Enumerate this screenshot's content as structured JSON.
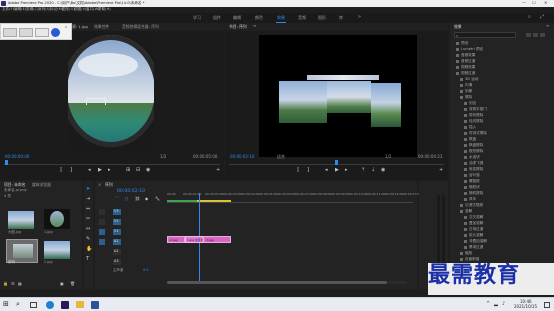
{
  "titlebar": {
    "title": "Adobe Premiere Pro 2020 - C:\\用户\\Bo\\文档\\Adobe\\Premiere Pro\\14.0\\未命名 *"
  },
  "menu": [
    "文件(F)",
    "编辑(E)",
    "剪辑(C)",
    "序列(S)",
    "标记(M)",
    "图形(G)",
    "视图(V)",
    "窗口(W)",
    "帮助(H)"
  ],
  "workspaces": [
    "学习",
    "组件",
    "编辑",
    "颜色",
    "效果",
    "音频",
    "图形",
    "库"
  ],
  "active_workspace": "效果",
  "source_monitor": {
    "tabs": [
      "源: 1.jpg",
      "效果控件",
      "音频剪辑混合器: 序列"
    ],
    "timecode_left": "00:00:00:00",
    "zoom": "1/2",
    "timecode_right": "00:00:05:00"
  },
  "program_monitor": {
    "tab": "节目: 序列",
    "timecode_left": "00:00:02:10",
    "fit": "适合",
    "zoom": "1/2",
    "timecode_right": "00:00:04:23"
  },
  "project": {
    "tabs": [
      "项目: 未命名",
      "媒体浏览器"
    ],
    "name": "未命名.prproj",
    "item_count": "4 项",
    "items": [
      {
        "label": "大图.jpg",
        "duration": "5:00"
      },
      {
        "label": "1.jpg",
        "duration": "5:00"
      },
      {
        "label": "序列",
        "duration": "4:23"
      },
      {
        "label": "2.jpg",
        "duration": "5:00"
      }
    ]
  },
  "timeline": {
    "tab": "序列",
    "timecode": "00:00:02:10",
    "ruler": [
      "00:00",
      "00:00:01:00",
      "00:00:02:00",
      "00:00:03:00",
      "00:00:04:00",
      "00:00:05:00",
      "00:00:06:00",
      "00:00:07:00",
      "00:00:08:00",
      "00:00:09:00",
      "00:00:10:00",
      "00:00:11:00",
      "00:00:12:00",
      "00:00:13:00",
      "00:00:14:00"
    ],
    "tracks": [
      "V3",
      "V2",
      "V1",
      "A1",
      "A2",
      "A3"
    ],
    "master_label": "主声道",
    "master_value": "0.0",
    "clips": [
      "2.jpg",
      "1.jpg 交叉溶解",
      "2.jpg"
    ]
  },
  "effects": {
    "title": "效果",
    "rows": [
      "预设",
      "Lumetri 预设",
      "音频效果",
      "音频过渡",
      "视频效果",
      "视频过渡",
      "3D 运动",
      "内滑",
      "划像",
      "擦除",
      "划出",
      "双侧平推门",
      "带状擦除",
      "径向擦除",
      "插入",
      "时钟式擦除",
      "棋盘",
      "棋盘擦除",
      "楔形擦除",
      "水波块",
      "油漆飞溅",
      "渐变擦除",
      "百叶窗",
      "螺旋框",
      "随机块",
      "随机擦除",
      "风车",
      "沉浸式视频",
      "溶解",
      "交叉溶解",
      "叠加溶解",
      "白场过渡",
      "胶片溶解",
      "非叠加溶解",
      "黑场过渡",
      "缩放",
      "页面剥落"
    ]
  },
  "watermark": "最需教育",
  "taskbar": {
    "time": "10:46",
    "date": "2021/10/15"
  }
}
